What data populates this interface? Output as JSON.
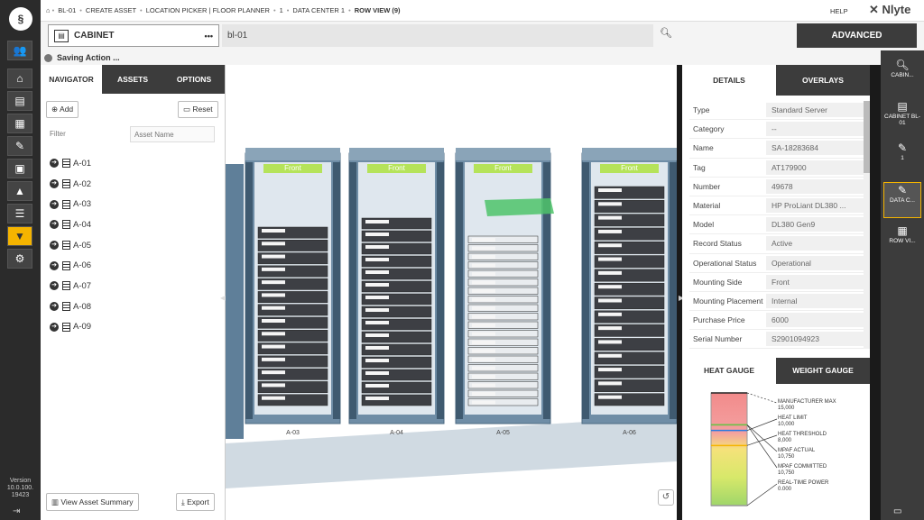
{
  "rail": {
    "logo": "§",
    "version": [
      "Version",
      "10.0.100.",
      "19423"
    ]
  },
  "breadcrumb": [
    {
      "label": "BL-01"
    },
    {
      "label": "CREATE ASSET"
    },
    {
      "label": "LOCATION PICKER | FLOOR PLANNER"
    },
    {
      "label": "1"
    },
    {
      "label": "DATA CENTER 1"
    },
    {
      "label": "ROW VIEW (9)"
    }
  ],
  "header": {
    "help": "HELP",
    "brand": "Nlyte"
  },
  "search": {
    "type_label": "CABINET",
    "value": "bl-01",
    "advanced_label": "ADVANCED"
  },
  "status": {
    "text": "Saving Action ..."
  },
  "navigator": {
    "tabs": [
      "NAVIGATOR",
      "ASSETS",
      "OPTIONS"
    ],
    "add_label": "Add",
    "reset_label": "Reset",
    "filter_label": "Filter",
    "filter_placeholder": "Asset Name",
    "items": [
      "A-01",
      "A-02",
      "A-03",
      "A-04",
      "A-05",
      "A-06",
      "A-07",
      "A-08",
      "A-09"
    ],
    "summary_label": "View Asset Summary",
    "export_label": "Export"
  },
  "racks": {
    "labels": [
      "A-03",
      "A-04",
      "A-05",
      "A-06"
    ],
    "front_label": "Front"
  },
  "details": {
    "tabs": [
      "DETAILS",
      "OVERLAYS"
    ],
    "rows": [
      {
        "key": "Type",
        "value": "Standard Server"
      },
      {
        "key": "Category",
        "value": "--"
      },
      {
        "key": "Name",
        "value": "SA-18283684"
      },
      {
        "key": "Tag",
        "value": "AT179900"
      },
      {
        "key": "Number",
        "value": "49678"
      },
      {
        "key": "Material",
        "value": "HP ProLiant DL380 ..."
      },
      {
        "key": "Model",
        "value": "DL380 Gen9"
      },
      {
        "key": "Record Status",
        "value": "Active"
      },
      {
        "key": "Operational Status",
        "value": "Operational"
      },
      {
        "key": "Mounting Side",
        "value": "Front"
      },
      {
        "key": "Mounting Placement",
        "value": "Internal"
      },
      {
        "key": "Purchase Price",
        "value": "6000"
      },
      {
        "key": "Serial Number",
        "value": "S2901094923"
      }
    ]
  },
  "gauge": {
    "tabs": [
      "HEAT GAUGE",
      "WEIGHT GAUGE"
    ],
    "max": 15000,
    "levels": [
      {
        "name": "MANUFACTURER MAX",
        "value": "15,000",
        "v": 15000
      },
      {
        "name": "HEAT LIMIT",
        "value": "10,000",
        "v": 10000
      },
      {
        "name": "HEAT THRESHOLD",
        "value": "8,000",
        "v": 8000
      },
      {
        "name": "MPAF ACTUAL",
        "value": "10,750",
        "v": 10750
      },
      {
        "name": "MPAF COMMITTED",
        "value": "10,750",
        "v": 10750
      },
      {
        "name": "REAL-TIME POWER",
        "value": "0.000",
        "v": 0
      }
    ]
  },
  "right_rail": [
    {
      "icon": "search-icon",
      "label": "CABIN..."
    },
    {
      "icon": "cabinet-icon",
      "label": "CABINET BL-01"
    },
    {
      "icon": "edit-icon",
      "label": "1"
    },
    {
      "icon": "edit-icon",
      "label": "DATA C..."
    },
    {
      "icon": "row-view-icon",
      "label": "ROW VI..."
    }
  ]
}
